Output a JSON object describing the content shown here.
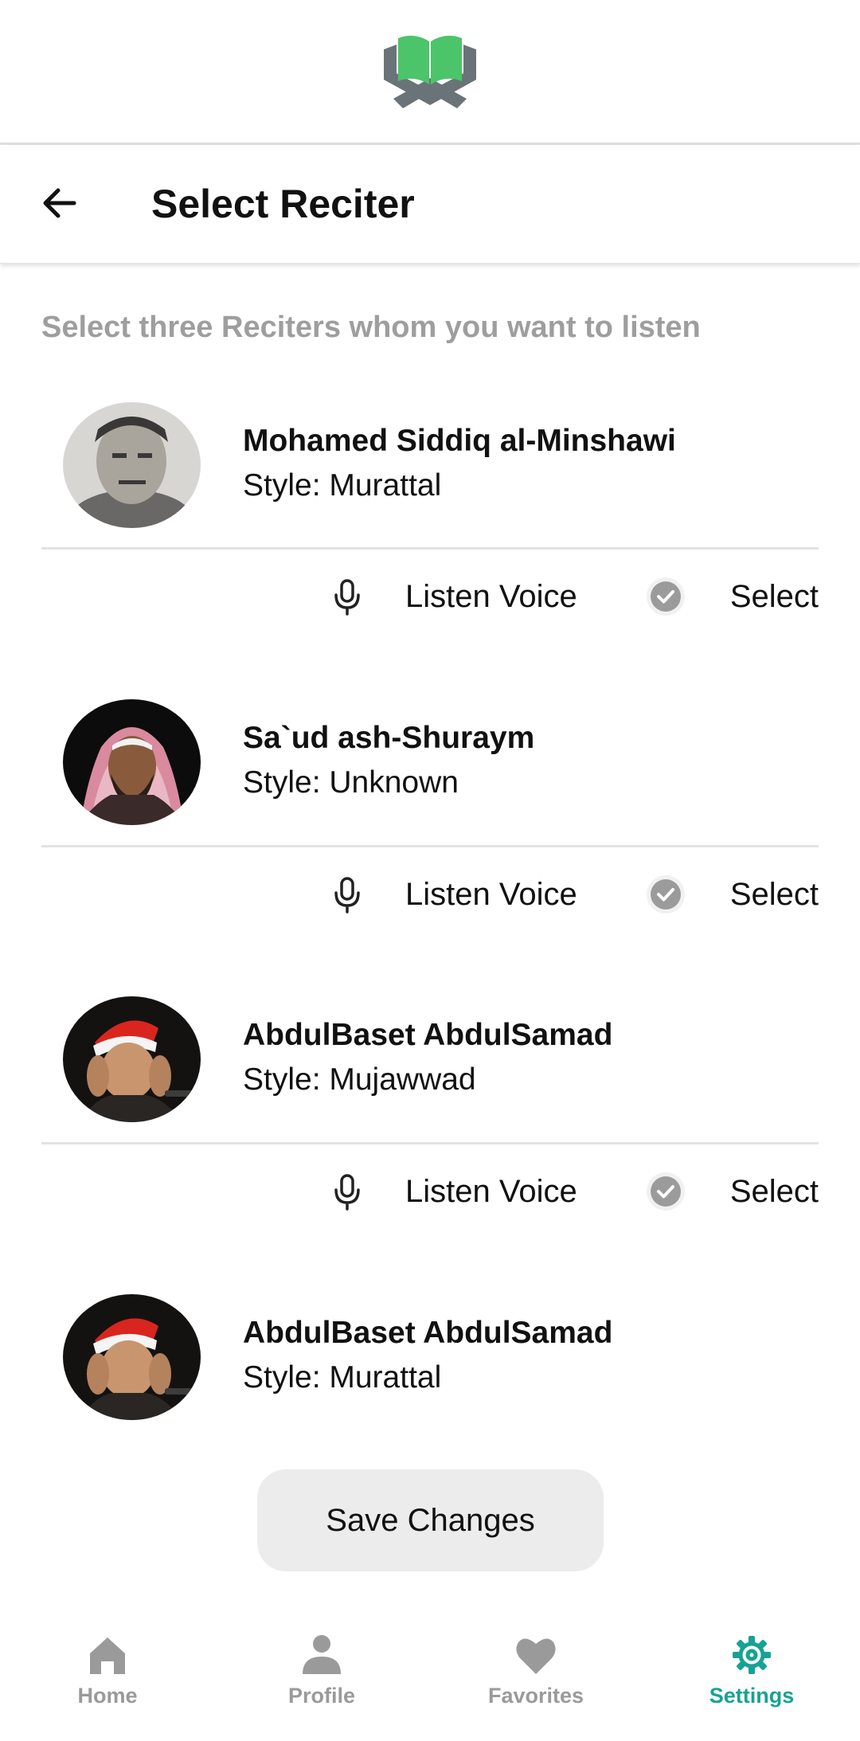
{
  "header": {
    "title": "Select Reciter",
    "back_icon": "arrow-left-icon"
  },
  "instruction": "Select three Reciters whom you want to listen",
  "reciters": [
    {
      "name": "Mohamed Siddiq al-Minshawi",
      "style": "Style: Murattal",
      "listen_label": "Listen Voice",
      "select_label": "Select"
    },
    {
      "name": "Sa`ud ash-Shuraym",
      "style": "Style: Unknown",
      "listen_label": "Listen Voice",
      "select_label": "Select"
    },
    {
      "name": "AbdulBaset AbdulSamad",
      "style": "Style: Mujawwad",
      "listen_label": "Listen Voice",
      "select_label": "Select"
    },
    {
      "name": "AbdulBaset AbdulSamad",
      "style": "Style: Murattal"
    }
  ],
  "save_button": "Save Changes",
  "nav": [
    {
      "label": "Home",
      "icon": "home-icon"
    },
    {
      "label": "Profile",
      "icon": "person-icon"
    },
    {
      "label": "Favorites",
      "icon": "heart-icon"
    },
    {
      "label": "Settings",
      "icon": "gear-icon",
      "active": true
    }
  ],
  "colors": {
    "accent": "#17a294",
    "logo_green": "#4cc46a",
    "logo_gray": "#6a7478",
    "muted_text": "#9e9e9e",
    "button_bg": "#ececec"
  }
}
